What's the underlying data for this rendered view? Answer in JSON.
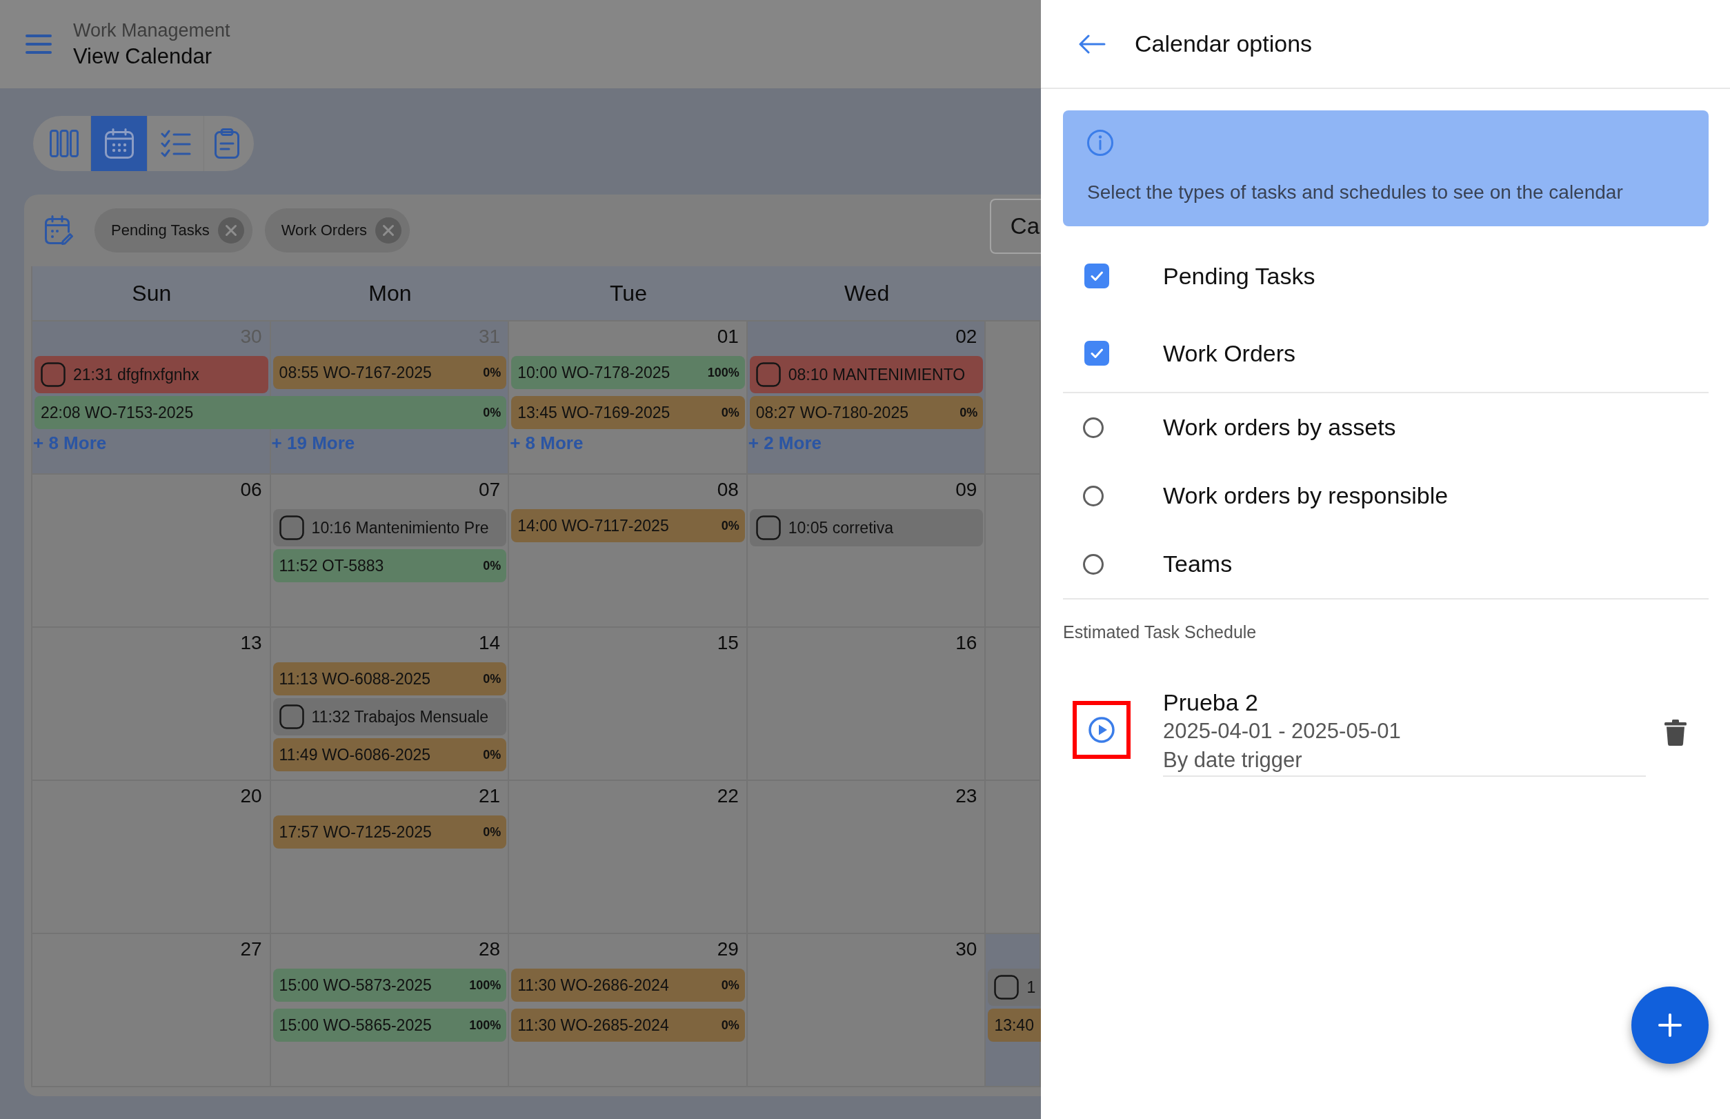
{
  "header": {
    "module": "Work Management",
    "title": "View Calendar"
  },
  "view_switcher": [
    {
      "kind": "board",
      "selected": false
    },
    {
      "kind": "calendar",
      "selected": true
    },
    {
      "kind": "checklist",
      "selected": false
    },
    {
      "kind": "clipboard",
      "selected": false
    }
  ],
  "calendar": {
    "filters": [
      {
        "label": "Pending Tasks"
      },
      {
        "label": "Work Orders"
      }
    ],
    "toolbar_button": {
      "label": "Ca"
    },
    "weekdays": [
      "Sun",
      "Mon",
      "Tue",
      "Wed"
    ],
    "weeks": [
      {
        "days": [
          {
            "number": "30",
            "in_month": false,
            "highlighted": true,
            "events": [
              {
                "kind": "task",
                "label": "21:31 dfgfnxfgnhx",
                "checked": false,
                "continues_next_day": false,
                "color": "#874642"
              },
              {
                "kind": "order",
                "label": "22:08 WO-7153-2025",
                "progress": "0%",
                "continues_next_day": true,
                "color": "#5d7f64"
              }
            ],
            "more": "+ 8 More"
          },
          {
            "number": "31",
            "in_month": false,
            "highlighted": true,
            "events": [
              {
                "kind": "order",
                "label": "08:55 WO-7167-2025",
                "progress": "0%",
                "continues_next_day": false,
                "color": "#7f653f"
              }
            ],
            "more": "+ 19 More"
          },
          {
            "number": "01",
            "in_month": true,
            "highlighted": false,
            "events": [
              {
                "kind": "order",
                "label": "10:00 WO-7178-2025",
                "progress": "100%",
                "continues_next_day": false,
                "color": "#5d7f64"
              },
              {
                "kind": "order",
                "label": "13:45 WO-7169-2025",
                "progress": "0%",
                "continues_next_day": false,
                "color": "#7f653f"
              }
            ],
            "more": "+ 8 More"
          },
          {
            "number": "02",
            "in_month": true,
            "highlighted": true,
            "events": [
              {
                "kind": "task",
                "label": "08:10 MANTENIMIENTO",
                "checked": false,
                "continues_next_day": false,
                "color": "#874642"
              },
              {
                "kind": "order",
                "label": "08:27 WO-7180-2025",
                "progress": "0%",
                "continues_next_day": false,
                "color": "#7f653f"
              }
            ],
            "more": "+ 2 More"
          },
          {
            "highlighted": false
          }
        ]
      },
      {
        "days": [
          {
            "number": "06",
            "in_month": true,
            "highlighted": false
          },
          {
            "number": "07",
            "in_month": true,
            "highlighted": false,
            "events": [
              {
                "kind": "task",
                "label": "10:16 Mantenimiento Pre",
                "checked": false,
                "continues_next_day": false,
                "color": "#717171"
              },
              {
                "kind": "order",
                "label": "11:52 OT-5883",
                "progress": "0%",
                "continues_next_day": false,
                "color": "#5d7f64"
              }
            ]
          },
          {
            "number": "08",
            "in_month": true,
            "highlighted": false,
            "events": [
              {
                "kind": "order",
                "label": "14:00 WO-7117-2025",
                "progress": "0%",
                "continues_next_day": false,
                "color": "#7f653f"
              }
            ]
          },
          {
            "number": "09",
            "in_month": true,
            "highlighted": false,
            "events": [
              {
                "kind": "task",
                "label": "10:05 corretiva",
                "checked": false,
                "continues_next_day": false,
                "color": "#717171"
              }
            ]
          },
          {
            "highlighted": false
          }
        ]
      },
      {
        "days": [
          {
            "number": "13",
            "in_month": true,
            "highlighted": false
          },
          {
            "number": "14",
            "in_month": true,
            "highlighted": false,
            "events": [
              {
                "kind": "order",
                "label": "11:13 WO-6088-2025",
                "progress": "0%",
                "continues_next_day": false,
                "color": "#7f653f"
              },
              {
                "kind": "task",
                "label": "11:32 Trabajos Mensuale",
                "checked": false,
                "continues_next_day": false,
                "color": "#717171"
              },
              {
                "kind": "order",
                "label": "11:49 WO-6086-2025",
                "progress": "0%",
                "continues_next_day": false,
                "color": "#7f653f"
              }
            ]
          },
          {
            "number": "15",
            "in_month": true,
            "highlighted": false
          },
          {
            "number": "16",
            "in_month": true,
            "highlighted": false
          },
          {
            "highlighted": false
          }
        ]
      },
      {
        "days": [
          {
            "number": "20",
            "in_month": true,
            "highlighted": false
          },
          {
            "number": "21",
            "in_month": true,
            "highlighted": false,
            "events": [
              {
                "kind": "order",
                "label": "17:57 WO-7125-2025",
                "progress": "0%",
                "continues_next_day": false,
                "color": "#7f653f"
              }
            ]
          },
          {
            "number": "22",
            "in_month": true,
            "highlighted": false
          },
          {
            "number": "23",
            "in_month": true,
            "highlighted": false
          },
          {
            "highlighted": false
          }
        ]
      },
      {
        "days": [
          {
            "number": "27",
            "in_month": true,
            "highlighted": false
          },
          {
            "number": "28",
            "in_month": true,
            "highlighted": false,
            "events": [
              {
                "kind": "order",
                "label": "15:00 WO-5873-2025",
                "progress": "100%",
                "continues_next_day": false,
                "color": "#5d7f64"
              },
              {
                "kind": "order",
                "label": "15:00 WO-5865-2025",
                "progress": "100%",
                "continues_next_day": false,
                "color": "#5d7f64"
              }
            ]
          },
          {
            "number": "29",
            "in_month": true,
            "highlighted": false,
            "events": [
              {
                "kind": "order",
                "label": "11:30 WO-2686-2024",
                "progress": "0%",
                "continues_next_day": false,
                "color": "#7f653f"
              },
              {
                "kind": "order",
                "label": "11:30 WO-2685-2024",
                "progress": "0%",
                "continues_next_day": false,
                "color": "#7f653f"
              }
            ]
          },
          {
            "number": "30",
            "in_month": true,
            "highlighted": false
          },
          {
            "highlighted": true,
            "events": [
              {
                "kind": "task",
                "label": "1",
                "checked": false,
                "color": "#717171"
              },
              {
                "kind": "order",
                "label": "13:40",
                "color": "#7f653f"
              }
            ]
          }
        ]
      }
    ]
  },
  "options_panel": {
    "title": "Calendar options",
    "info": "Select the types of tasks and schedules to see on the calendar",
    "task_types": [
      {
        "label": "Pending Tasks",
        "checked": true
      },
      {
        "label": "Work Orders",
        "checked": true
      }
    ],
    "views": [
      {
        "label": "Work orders by assets",
        "selected": false
      },
      {
        "label": "Work orders by responsible",
        "selected": false
      },
      {
        "label": "Teams",
        "selected": false
      }
    ],
    "schedule_heading": "Estimated Task Schedule",
    "schedules": [
      {
        "name": "Prueba 2",
        "dates": "2025-04-01 - 2025-05-01",
        "trigger": "By date trigger",
        "highlighted": true
      }
    ]
  }
}
